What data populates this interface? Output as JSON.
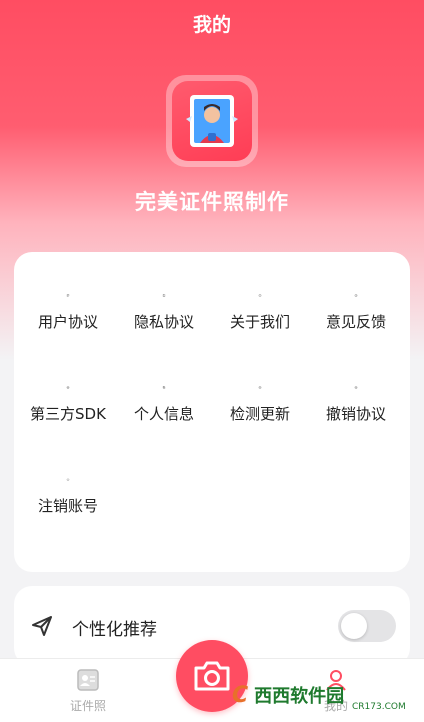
{
  "header": {
    "title": "我的"
  },
  "app": {
    "name": "完美证件照制作"
  },
  "menu": {
    "items": [
      {
        "label": "用户协议",
        "icon": "document-icon"
      },
      {
        "label": "隐私协议",
        "icon": "book-icon"
      },
      {
        "label": "关于我们",
        "icon": "info-icon"
      },
      {
        "label": "意见反馈",
        "icon": "question-icon"
      },
      {
        "label": "第三方SDK",
        "icon": "cube-icon"
      },
      {
        "label": "个人信息",
        "icon": "copy-icon"
      },
      {
        "label": "检测更新",
        "icon": "upload-icon"
      },
      {
        "label": "撤销协议",
        "icon": "undo-icon"
      },
      {
        "label": "注销账号",
        "icon": "power-icon"
      }
    ]
  },
  "recommend": {
    "label": "个性化推荐",
    "enabled": false
  },
  "tabbar": {
    "left_label": "证件照",
    "right_label": "我的"
  },
  "watermark": {
    "brand": "西西软件园",
    "url": "CR173.COM"
  },
  "colors": {
    "accent": "#ff4d62"
  }
}
